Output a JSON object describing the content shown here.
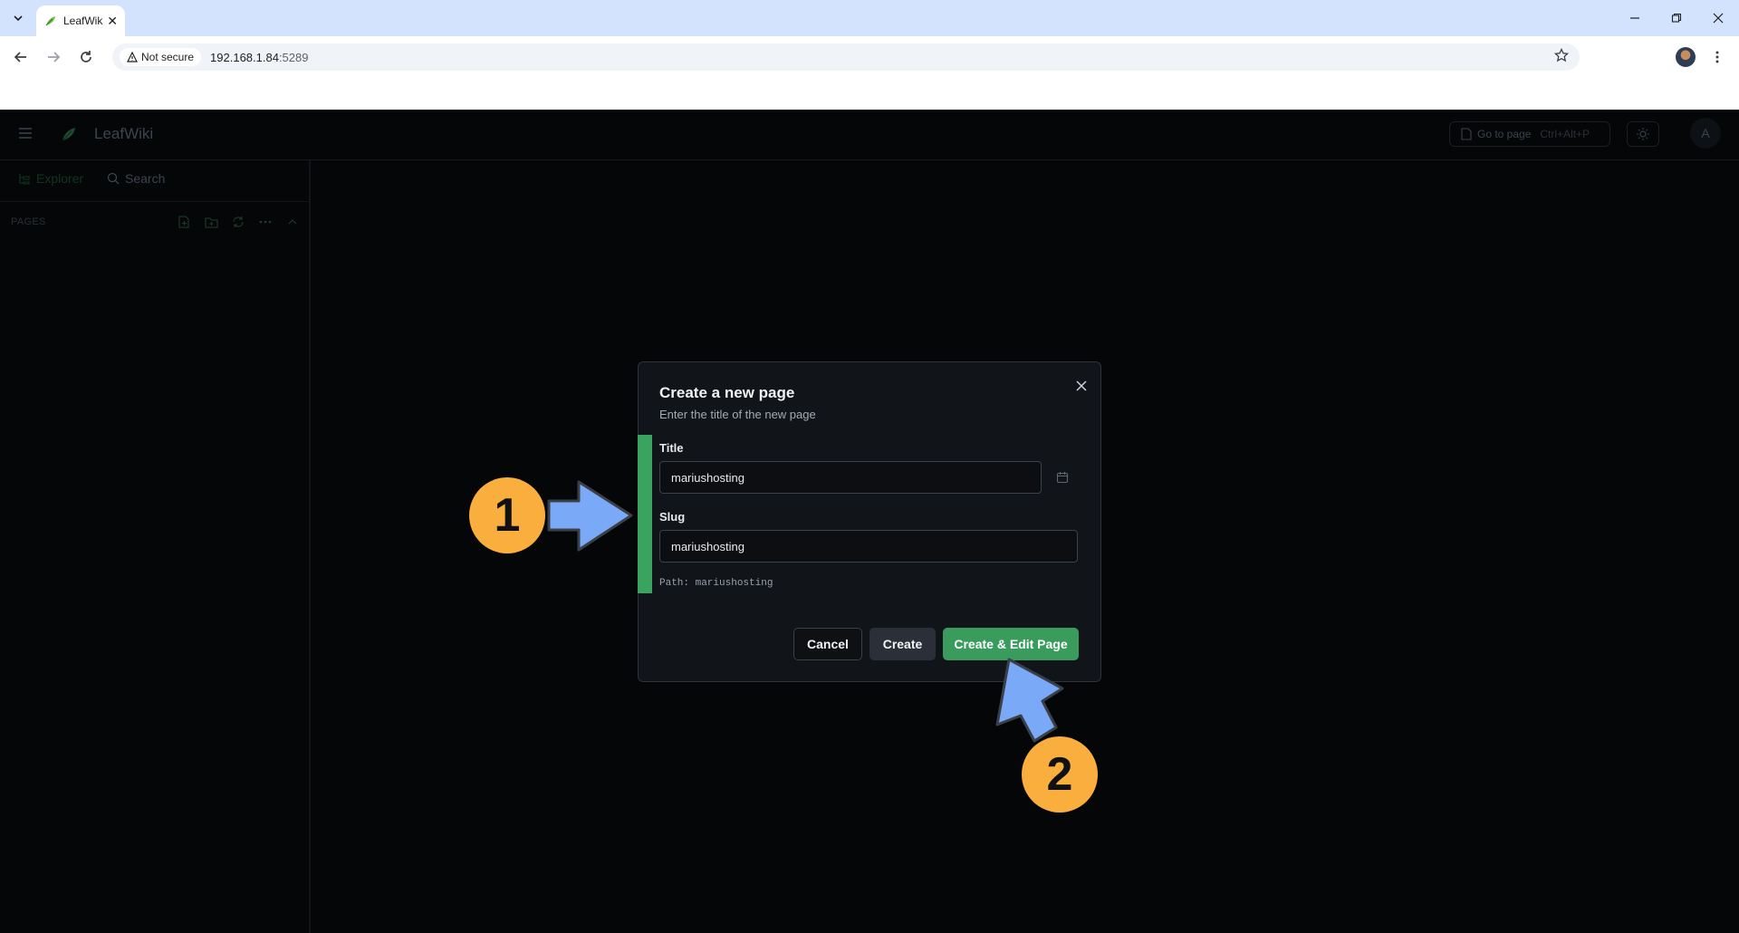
{
  "browser": {
    "tab_title": "LeafWiki",
    "tab_close": "✕",
    "security_label": "Not secure",
    "url_host": "192.168.1.84",
    "url_port": ":5289"
  },
  "app": {
    "name": "LeafWiki",
    "goto_label": "Go to page",
    "goto_shortcut": "Ctrl+Alt+P",
    "user_initial": "A",
    "sidebar": {
      "tab_explorer": "Explorer",
      "tab_search": "Search",
      "section_pages": "PAGES"
    }
  },
  "modal": {
    "title": "Create a new page",
    "subtitle": "Enter the title of the new page",
    "title_label": "Title",
    "title_value": "mariushosting",
    "slug_label": "Slug",
    "slug_value": "mariushosting",
    "path_text": "Path: mariushosting",
    "cancel_label": "Cancel",
    "create_label": "Create",
    "create_edit_label": "Create & Edit Page"
  },
  "annotations": {
    "badge_1": "1",
    "badge_2": "2",
    "badge_color": "#f9ae3d",
    "arrow_color": "#7aaaf7"
  },
  "colors": {
    "accent_green": "#3a9c5c",
    "modal_bg": "#111418",
    "page_bg": "#050607"
  }
}
